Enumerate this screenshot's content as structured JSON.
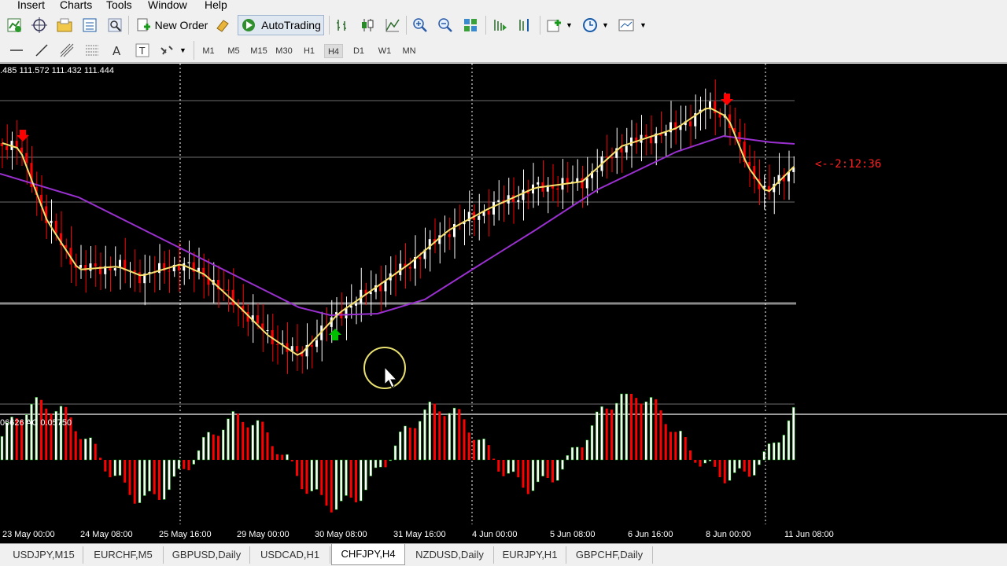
{
  "menu": [
    "Insert",
    "Charts",
    "Tools",
    "Window",
    "Help"
  ],
  "toolbar": {
    "new_order": "New Order",
    "autotrading": "AutoTrading",
    "timeframes": [
      "M1",
      "M5",
      "M15",
      "M30",
      "H1",
      "H4",
      "D1",
      "W1",
      "MN"
    ],
    "active_timeframe": "H4"
  },
  "chart": {
    "ohlc_label": ".485 111.572 111.432 111.444",
    "indicator_label": "06626  AC 0.05750",
    "timer_label": "<--2:12:36",
    "time_axis": [
      "23 May 00:00",
      "24 May 08:00",
      "25 May 16:00",
      "29 May 00:00",
      "30 May 08:00",
      "31 May 16:00",
      "4 Jun 00:00",
      "5 Jun 08:00",
      "6 Jun 16:00",
      "8 Jun 00:00",
      "11 Jun 08:00"
    ],
    "colors": {
      "background": "#000000",
      "bull": "#ffffff",
      "bear": "#ff0000",
      "fast_ma": "#f5e06e",
      "slow_ma": "#9b30d0",
      "buy_arrow": "#00c000",
      "sell_arrow": "#ff0000",
      "ac_up": "#00a000",
      "ac_down": "#ff0000"
    }
  },
  "tabs": [
    "USDJPY,M15",
    "EURCHF,M5",
    "GBPUSD,Daily",
    "USDCAD,H1",
    "CHFJPY,H4",
    "NZDUSD,Daily",
    "EURJPY,H1",
    "GBPCHF,Daily"
  ],
  "active_tab": "CHFJPY,H4"
}
